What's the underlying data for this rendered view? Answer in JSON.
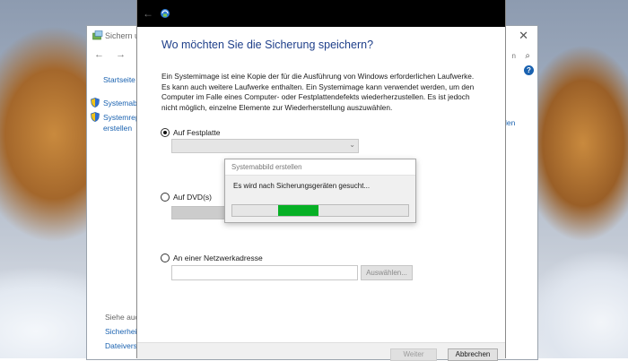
{
  "control_panel": {
    "title": "Sichern un",
    "search_partial": "n",
    "sidebar": {
      "home_link": "Startseite",
      "links": [
        "Systemab",
        "Systemrep",
        "erstellen"
      ],
      "see_also_label": "Siehe auc",
      "see_also_links": [
        "Sicherheit",
        "Dateiversi"
      ]
    },
    "right_link": "len",
    "help_glyph": "?"
  },
  "wizard": {
    "heading": "Wo möchten Sie die Sicherung speichern?",
    "description": "Ein Systemimage ist eine Kopie der für die Ausführung von Windows erforderlichen Laufwerke. Es kann auch weitere Laufwerke enthalten. Ein Systemimage kann verwendet werden, um den Computer im Falle eines Computer- oder Festplattendefekts wiederherzustellen. Es ist jedoch nicht möglich, einzelne Elemente zur Wiederherstellung auszuwählen.",
    "options": {
      "hard_disk": {
        "label": "Auf Festplatte",
        "selected": true
      },
      "dvd": {
        "label": "Auf DVD(s)",
        "selected": false
      },
      "network": {
        "label": "An einer Netzwerkadresse",
        "selected": false
      }
    },
    "network_path_value": "",
    "browse_label": "Auswählen...",
    "next_label": "Weiter",
    "cancel_label": "Abbrechen"
  },
  "progress_dialog": {
    "title": "Systemabbild erstellen",
    "message": "Es wird nach Sicherungsgeräten gesucht...",
    "indeterminate_segment_start": 0.26,
    "indeterminate_segment_width": 0.23,
    "bar_color": "#06b025"
  },
  "icons": {
    "control_panel_app": "backup-restore-icon",
    "wizard_app": "backup-wizard-icon",
    "shield": "uac-shield-icon"
  },
  "colors": {
    "heading": "#1e3f8a",
    "link": "#1a62b0",
    "titlebar": "#000000"
  }
}
